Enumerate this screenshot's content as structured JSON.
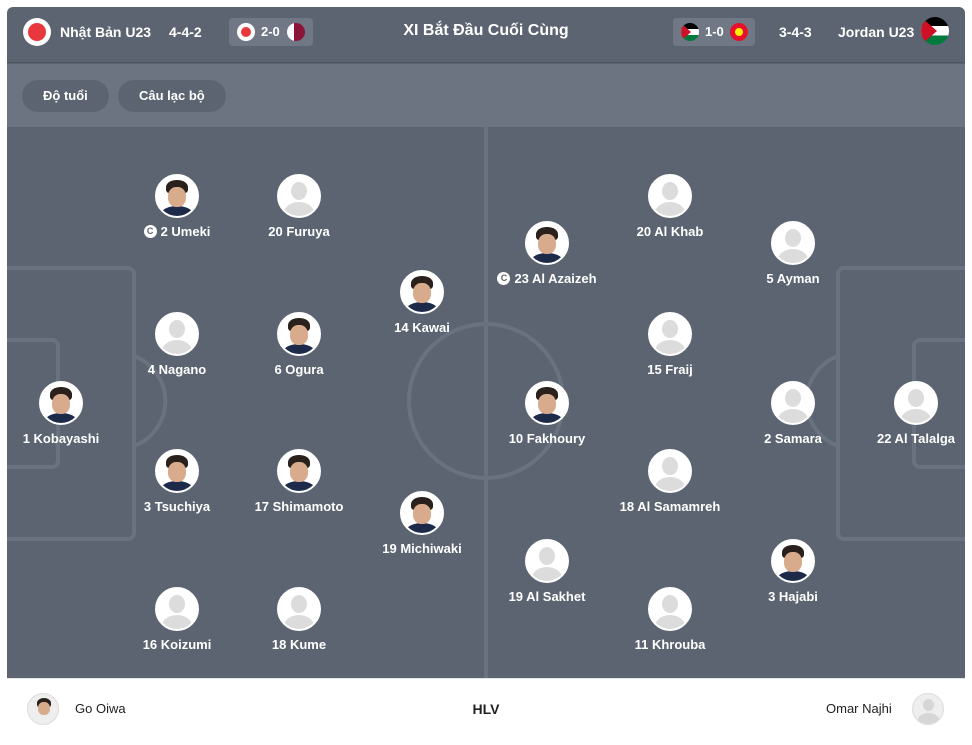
{
  "header": {
    "home_team": "Nhật Bản U23",
    "home_formation": "4-4-2",
    "home_last_score": "2-0",
    "title": "XI Bắt Đầu Cuối Cùng",
    "away_last_score": "1-0",
    "away_formation": "3-4-3",
    "away_team": "Jordan U23"
  },
  "filters": {
    "age": "Độ tuổi",
    "club": "Câu lạc bộ"
  },
  "captain_glyph": "C",
  "home_players": [
    {
      "name": "1 Kobayashi",
      "photo": true,
      "captain": false
    },
    {
      "name": "2 Umeki",
      "photo": true,
      "captain": true
    },
    {
      "name": "4 Nagano",
      "photo": false,
      "captain": false
    },
    {
      "name": "3 Tsuchiya",
      "photo": true,
      "captain": false
    },
    {
      "name": "16 Koizumi",
      "photo": false,
      "captain": false
    },
    {
      "name": "20 Furuya",
      "photo": false,
      "captain": false
    },
    {
      "name": "6 Ogura",
      "photo": true,
      "captain": false
    },
    {
      "name": "17 Shimamoto",
      "photo": true,
      "captain": false
    },
    {
      "name": "18 Kume",
      "photo": false,
      "captain": false
    },
    {
      "name": "14 Kawai",
      "photo": true,
      "captain": false
    },
    {
      "name": "19 Michiwaki",
      "photo": true,
      "captain": false
    }
  ],
  "away_players": [
    {
      "name": "23 Al Azaizeh",
      "photo": true,
      "captain": true
    },
    {
      "name": "10 Fakhoury",
      "photo": true,
      "captain": false
    },
    {
      "name": "19 Al Sakhet",
      "photo": false,
      "captain": false
    },
    {
      "name": "20 Al Khab",
      "photo": false,
      "captain": false
    },
    {
      "name": "15 Fraij",
      "photo": false,
      "captain": false
    },
    {
      "name": "18 Al Samamreh",
      "photo": false,
      "captain": false
    },
    {
      "name": "11 Khrouba",
      "photo": false,
      "captain": false
    },
    {
      "name": "5 Ayman",
      "photo": false,
      "captain": false
    },
    {
      "name": "2 Samara",
      "photo": false,
      "captain": false
    },
    {
      "name": "3 Hajabi",
      "photo": true,
      "captain": false
    },
    {
      "name": "22 Al Talalga",
      "photo": false,
      "captain": false
    }
  ],
  "footer": {
    "home_coach": "Go Oiwa",
    "label": "HLV",
    "away_coach": "Omar Najhi"
  }
}
